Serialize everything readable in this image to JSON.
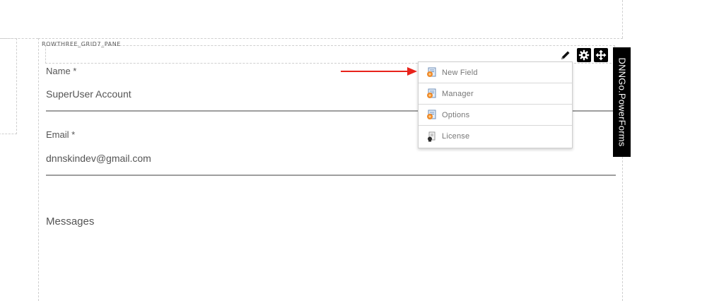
{
  "pane": {
    "label": "ROWTHREE_GRID7_PANE"
  },
  "form": {
    "name_label": "Name *",
    "name_value": "SuperUser Account",
    "email_label": "Email *",
    "email_value": "dnnskindev@gmail.com",
    "messages_label": "Messages"
  },
  "module": {
    "title": "DNNGo.PowerForms",
    "icons": [
      "pencil-icon",
      "gear-icon",
      "move-icon"
    ]
  },
  "menu": {
    "items": [
      {
        "label": "New Field",
        "icon": "form-field-icon"
      },
      {
        "label": "Manager",
        "icon": "form-manager-icon"
      },
      {
        "label": "Options",
        "icon": "form-options-icon"
      },
      {
        "label": "License",
        "icon": "license-icon"
      }
    ]
  },
  "colors": {
    "arrow": "#e8231b",
    "module_bar": "#000000"
  }
}
